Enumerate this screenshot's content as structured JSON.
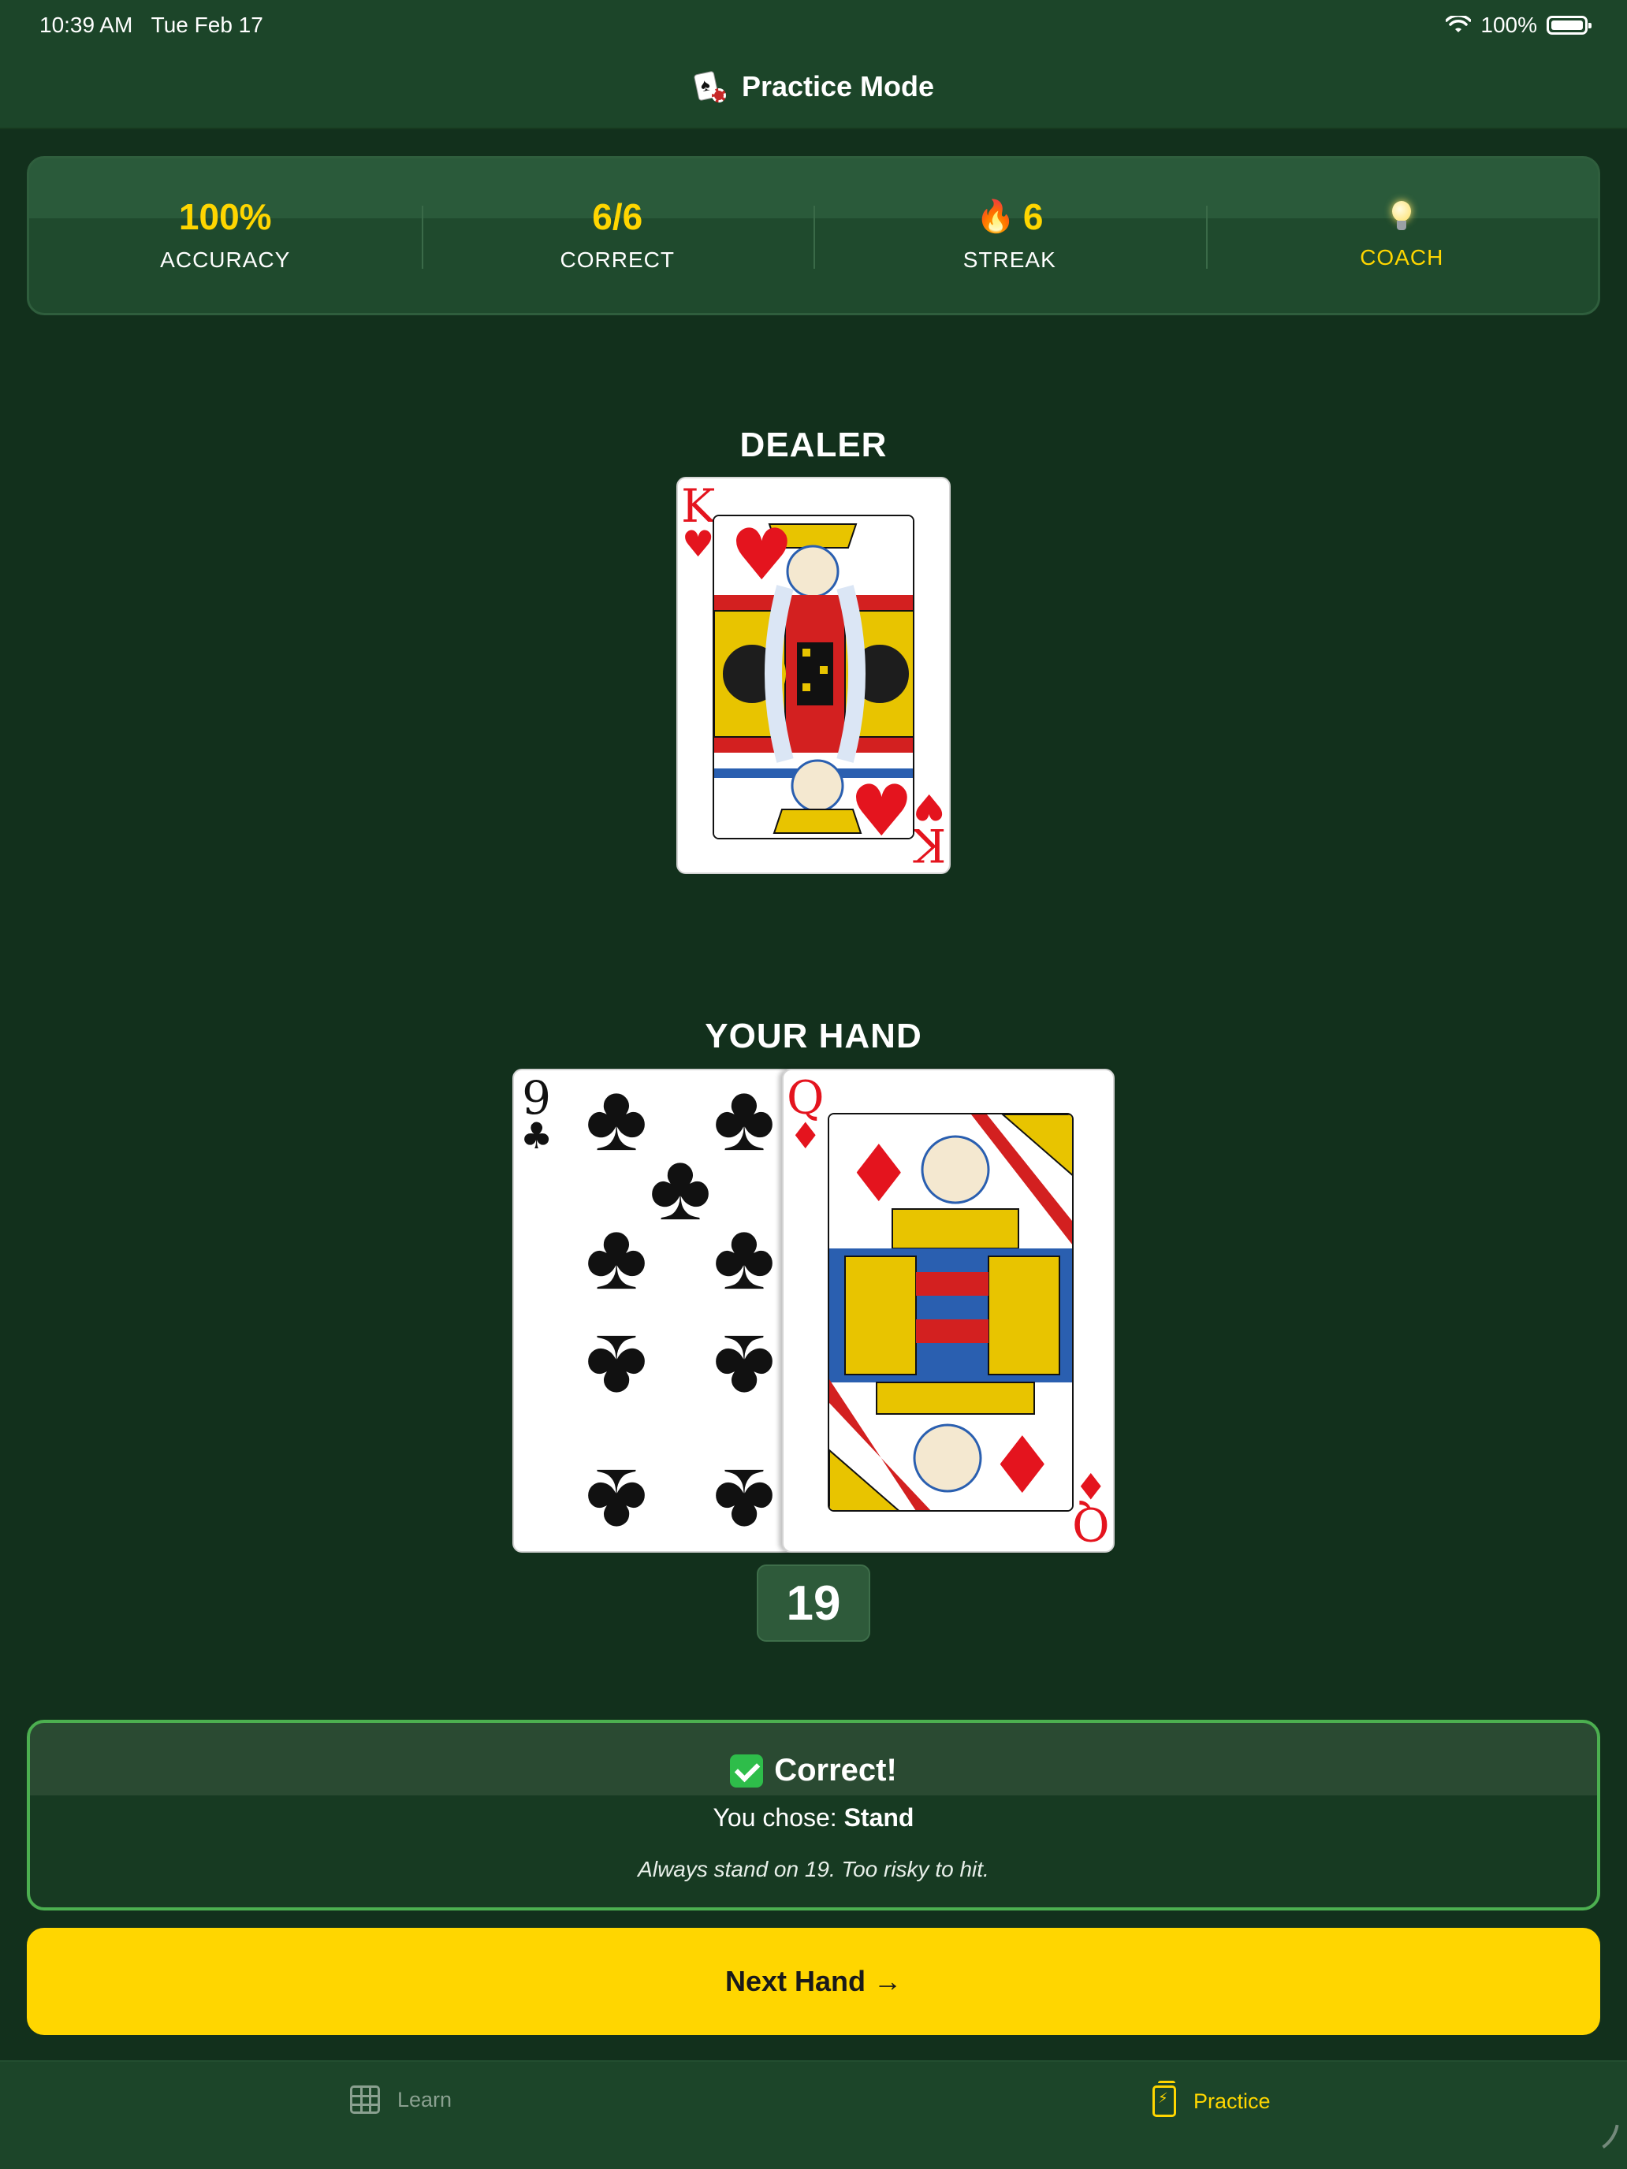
{
  "status_bar": {
    "time": "10:39 AM",
    "date": "Tue Feb 17",
    "battery": "100%"
  },
  "header": {
    "title": "Practice Mode"
  },
  "stats": {
    "accuracy": {
      "value": "100%",
      "label": "ACCURACY"
    },
    "correct": {
      "value": "6/6",
      "label": "CORRECT"
    },
    "streak": {
      "value": "6",
      "label": "STREAK"
    },
    "coach": {
      "label": "COACH"
    }
  },
  "dealer": {
    "label": "DEALER",
    "card": {
      "rank": "K",
      "suit": "♥"
    }
  },
  "hand": {
    "label": "YOUR HAND",
    "cards": [
      {
        "rank": "9",
        "suit": "♣"
      },
      {
        "rank": "Q",
        "suit": "♦"
      }
    ],
    "total": "19"
  },
  "result": {
    "title": "Correct!",
    "choice_prefix": "You chose:",
    "choice": "Stand",
    "tip": "Always stand on 19. Too risky to hit."
  },
  "next_button": {
    "label": "Next Hand →"
  },
  "tabs": [
    {
      "label": "Learn",
      "icon": "grid-icon"
    },
    {
      "label": "Practice",
      "icon": "practice-icon"
    }
  ],
  "colors": {
    "accent": "#ffd600",
    "background": "#12301c",
    "success": "#4caf50"
  }
}
